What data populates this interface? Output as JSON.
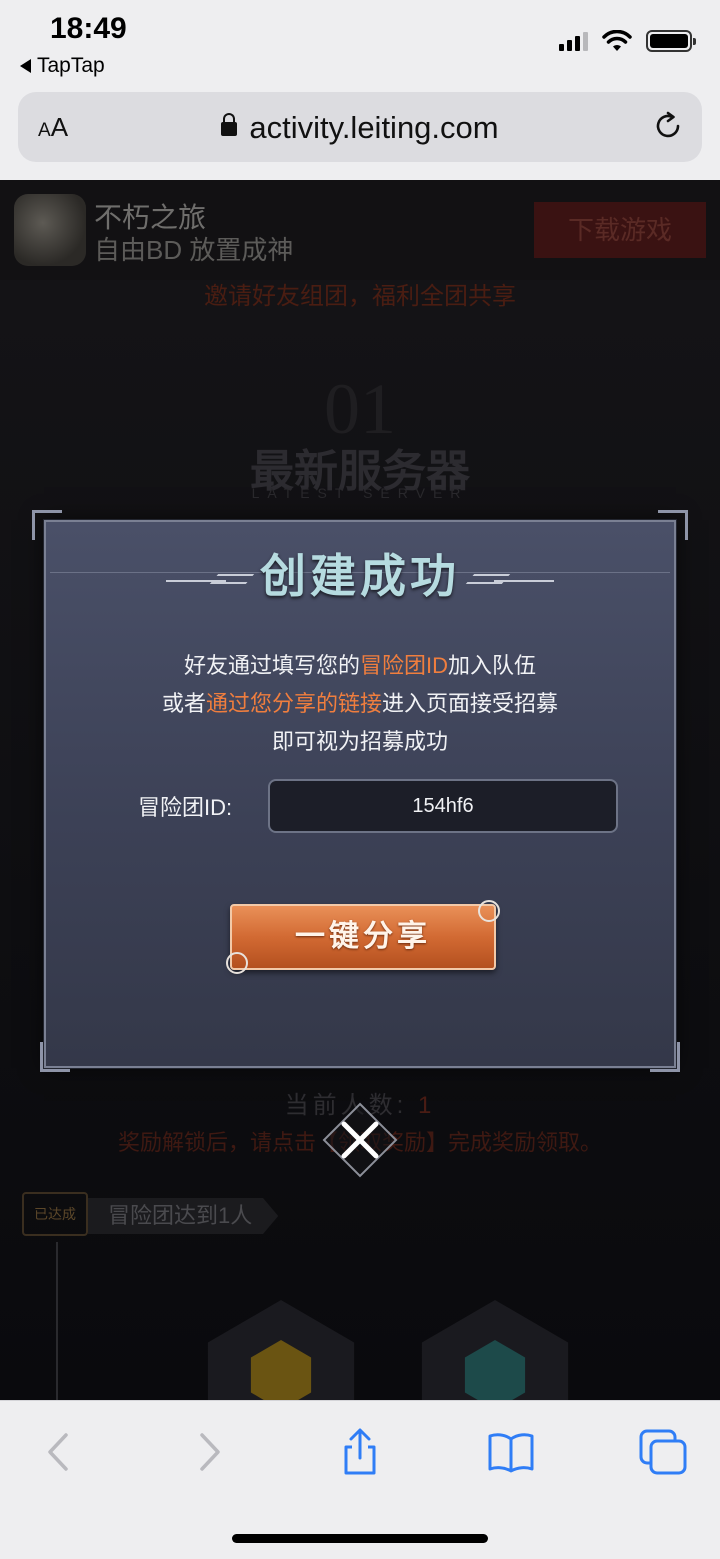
{
  "status_bar": {
    "time": "18:49",
    "back_app": "TapTap",
    "signal_bars_on": 3,
    "signal_bars_total": 4,
    "battery_level": 1.0
  },
  "browser": {
    "aa_label_small": "A",
    "aa_label_large": "A",
    "url": "activity.leiting.com"
  },
  "page": {
    "app_name": "不朽之旅",
    "app_subtitle": "自由BD 放置成神",
    "download_button": "下载游戏",
    "invite_banner": "邀请好友组团，福利全团共享",
    "section_number": "01",
    "section_title": "最新服务器",
    "section_subtitle": "LATEST SERVER",
    "member_count_label": "当前人数:",
    "member_count_value": "1",
    "reward_note": "奖励解锁后，请点击【领取奖励】完成奖励领取。",
    "reached_badge": "已达成",
    "milestone_label": "冒险团达到1人"
  },
  "modal": {
    "title": "创建成功",
    "line1_pre": "好友通过填写您的",
    "line1_highlight": "冒险团ID",
    "line1_post": "加入队伍",
    "line2_pre": "或者",
    "line2_highlight": "通过您分享的链接",
    "line2_post": "进入页面接受招募",
    "line3": "即可视为招募成功",
    "id_label": "冒险团ID:",
    "id_value": "154hf6",
    "share_button": "一键分享"
  },
  "toolbar": {
    "back": "chevron-left-icon",
    "forward": "chevron-right-icon",
    "share": "share-icon",
    "bookmarks": "book-icon",
    "tabs": "tabs-icon"
  },
  "colors": {
    "highlight": "#f07e3e",
    "modal_bg": "#41465c",
    "share_button": "#d26a33",
    "ios_blue": "#2f7df6"
  }
}
